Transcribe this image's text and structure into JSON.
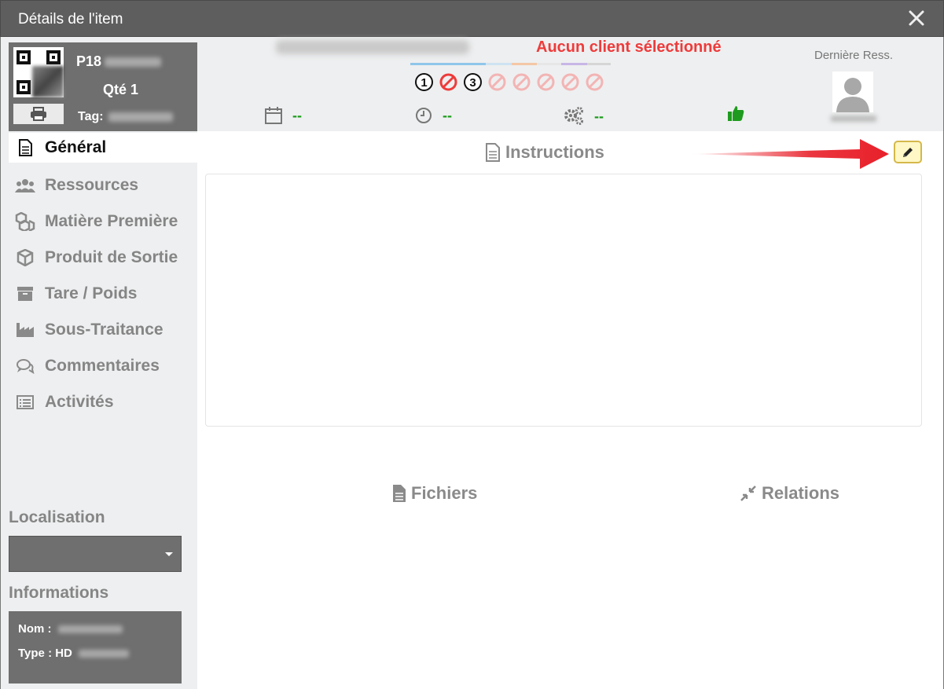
{
  "window": {
    "title": "Détails de l'item"
  },
  "item": {
    "code_prefix": "P18",
    "qty_label": "Qté 1",
    "tag_label": "Tag:"
  },
  "header": {
    "client_status": "Aucun client sélectionné",
    "last_resource_label": "Dernière Ress.",
    "steps": [
      {
        "label": "1",
        "state": "done"
      },
      {
        "label": "",
        "state": "blocked"
      },
      {
        "label": "3",
        "state": "done"
      },
      {
        "label": "",
        "state": "disabled"
      },
      {
        "label": "",
        "state": "disabled"
      },
      {
        "label": "",
        "state": "disabled"
      },
      {
        "label": "",
        "state": "disabled"
      },
      {
        "label": "",
        "state": "disabled"
      }
    ],
    "date_value": "--",
    "time_value": "--",
    "ops_value": "--"
  },
  "sidebar": {
    "items": [
      {
        "label": "Général",
        "icon": "document-icon",
        "active": true
      },
      {
        "label": "Ressources",
        "icon": "users-icon"
      },
      {
        "label": "Matière Première",
        "icon": "cubes-icon"
      },
      {
        "label": "Produit de Sortie",
        "icon": "cube-icon"
      },
      {
        "label": "Tare / Poids",
        "icon": "archive-icon"
      },
      {
        "label": "Sous-Traitance",
        "icon": "factory-icon"
      },
      {
        "label": "Commentaires",
        "icon": "comments-icon"
      },
      {
        "label": "Activités",
        "icon": "list-icon"
      }
    ],
    "location_title": "Localisation",
    "info_title": "Informations",
    "info": {
      "name_label": "Nom :",
      "type_label": "Type : HD"
    }
  },
  "main": {
    "instructions_title": "Instructions",
    "files_title": "Fichiers",
    "relations_title": "Relations"
  },
  "colors": {
    "accent_red": "#ee3b3b",
    "ok_green": "#1a9b1a",
    "titlebar": "#5e5e5e"
  }
}
